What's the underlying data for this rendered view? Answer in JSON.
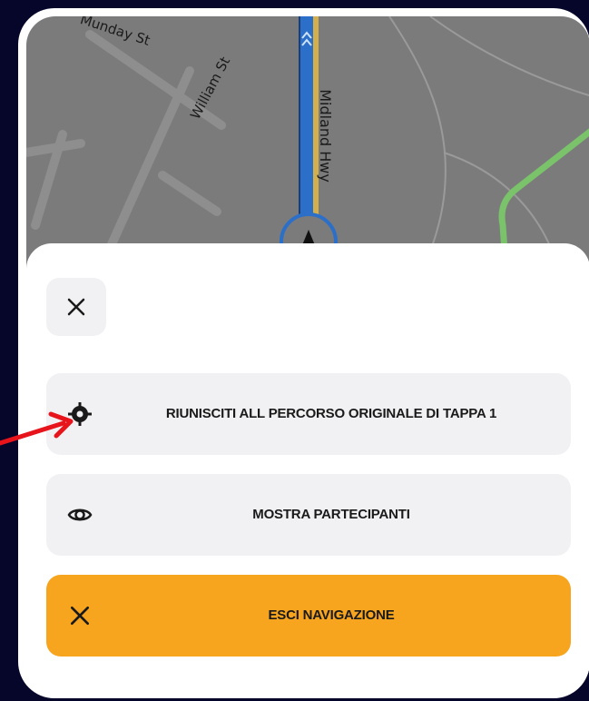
{
  "map": {
    "streets": [
      "Munday St",
      "William St",
      "Midland Hwy"
    ]
  },
  "sheet": {
    "close_icon": "close-icon",
    "actions": [
      {
        "label": "RIUNISCITI ALL PERCORSO ORIGINALE DI TAPPA 1",
        "icon": "crosshair-icon"
      },
      {
        "label": "MOSTRA PARTECIPANTI",
        "icon": "eye-icon"
      },
      {
        "label": "ESCI NAVIGAZIONE",
        "icon": "close-icon"
      }
    ]
  },
  "colors": {
    "primary_action": "#f7a41f",
    "route": "#2b6fc9",
    "annotation_arrow": "#e8141c",
    "background": "#05062a"
  }
}
